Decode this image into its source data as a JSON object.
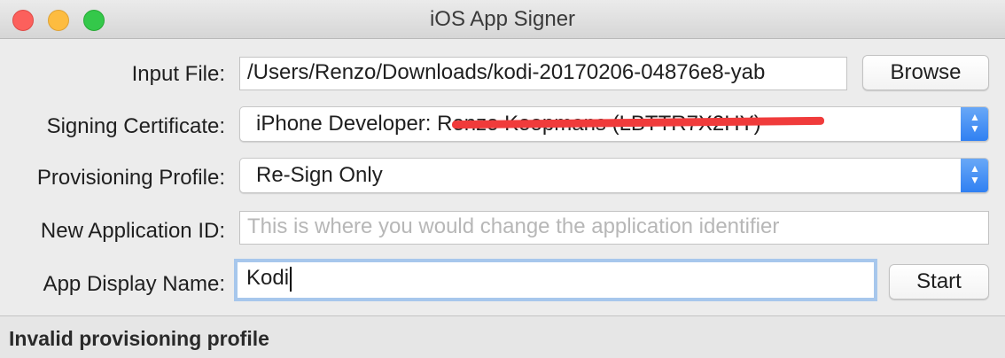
{
  "window": {
    "title": "iOS App Signer"
  },
  "form": {
    "input_file": {
      "label": "Input File:",
      "value": "/Users/Renzo/Downloads/kodi-20170206-04876e8-yab"
    },
    "browse_label": "Browse",
    "signing_certificate": {
      "label": "Signing Certificate:",
      "value": "iPhone Developer: Renzo Koopmans (LBTTR7X2HY)"
    },
    "provisioning_profile": {
      "label": "Provisioning Profile:",
      "value": "Re-Sign Only"
    },
    "new_application_id": {
      "label": "New Application ID:",
      "value": "",
      "placeholder": "This is where you would change the application identifier"
    },
    "app_display_name": {
      "label": "App Display Name:",
      "value": "Kodi"
    },
    "start_label": "Start"
  },
  "status": {
    "text": "Invalid provisioning profile"
  },
  "colors": {
    "accent": "#2e7ff2",
    "focus_ring": "#a7c7ec",
    "redaction": "#f03b3b"
  }
}
